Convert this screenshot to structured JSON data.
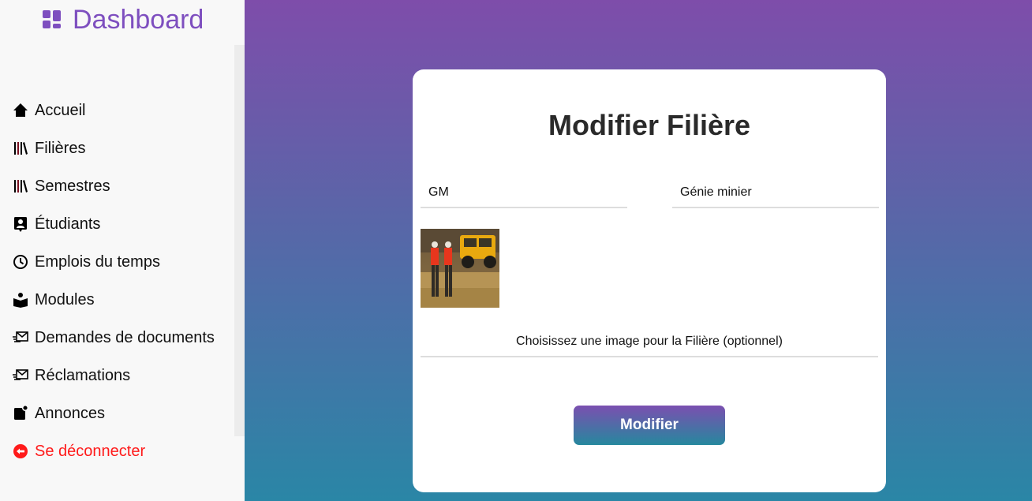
{
  "sidebar": {
    "brand": "Dashboard",
    "items": [
      {
        "label": "Accueil",
        "icon": "home-icon"
      },
      {
        "label": "Filières",
        "icon": "books-icon"
      },
      {
        "label": "Semestres",
        "icon": "books-icon"
      },
      {
        "label": "Étudiants",
        "icon": "student-badge-icon"
      },
      {
        "label": "Emplois du temps",
        "icon": "clock-icon"
      },
      {
        "label": "Modules",
        "icon": "reader-icon"
      },
      {
        "label": "Demandes de documents",
        "icon": "mail-send-icon"
      },
      {
        "label": "Réclamations",
        "icon": "mail-send-icon"
      },
      {
        "label": "Annonces",
        "icon": "notification-icon"
      },
      {
        "label": "Se déconnecter",
        "icon": "logout-icon"
      }
    ]
  },
  "form": {
    "title": "Modifier Filière",
    "code_value": "GM",
    "name_value": "Génie minier",
    "file_label": "Choisissez une image pour la Filière (optionnel)",
    "submit_label": "Modifier"
  },
  "colors": {
    "brand": "#7e4fbf",
    "gradient_top": "#7e4daa",
    "gradient_bottom": "#2a86a6",
    "logout": "#ff1a1a"
  }
}
